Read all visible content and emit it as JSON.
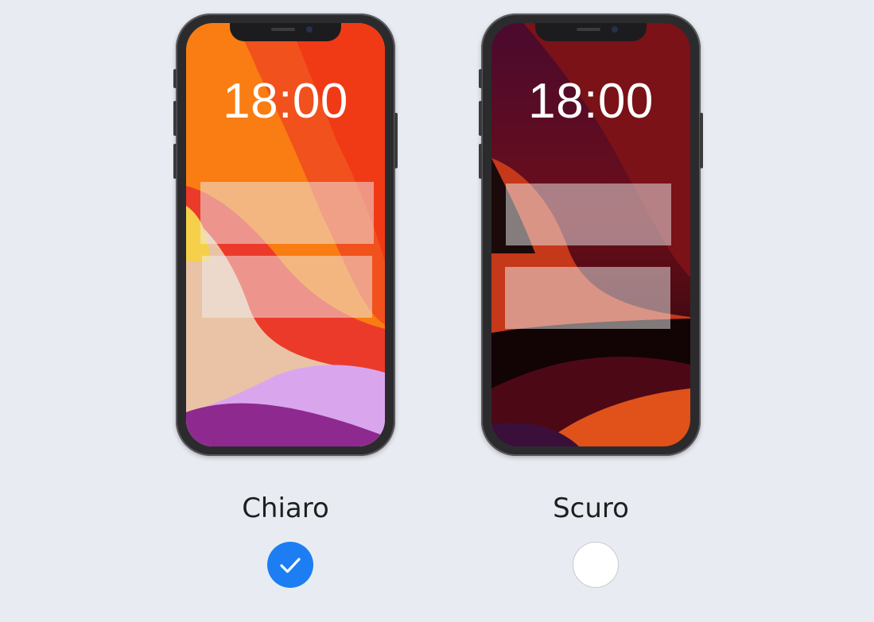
{
  "options": [
    {
      "label": "Chiaro",
      "time": "18:00",
      "selected": true,
      "wallpaper": "light-orange-wallpaper",
      "radio_icon": "checkmark-icon"
    },
    {
      "label": "Scuro",
      "time": "18:00",
      "selected": false,
      "wallpaper": "dark-red-wallpaper",
      "radio_icon": null
    }
  ],
  "colors": {
    "page_background": "#e8ecf2",
    "radio_selected": "#1c7ef2",
    "radio_unselected": "#ffffff",
    "phone_frame": "#2b2b2d",
    "label_text": "#1f1f1f"
  }
}
